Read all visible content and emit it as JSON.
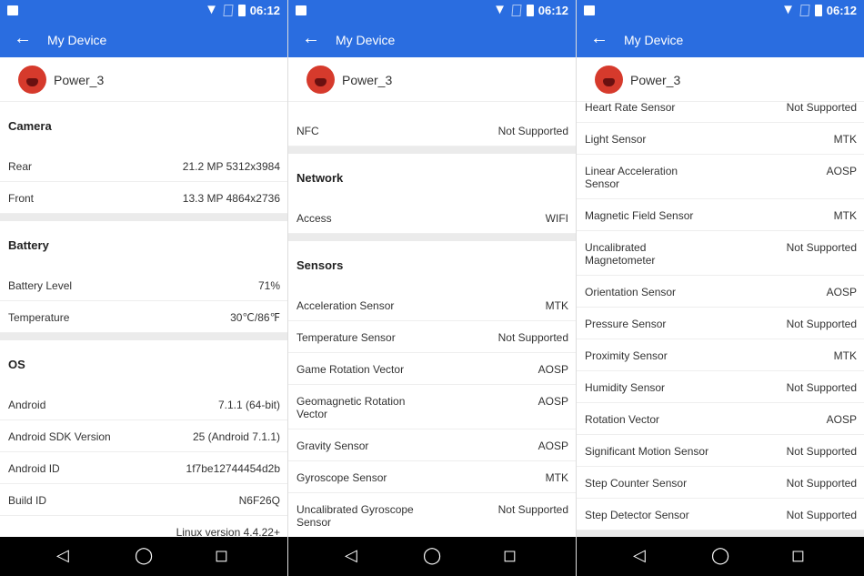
{
  "status": {
    "time": "06:12"
  },
  "appbar": {
    "title": "My Device"
  },
  "device": {
    "name": "Power_3"
  },
  "panels": [
    {
      "items": [
        {
          "type": "section",
          "label": "Camera"
        },
        {
          "type": "row",
          "label": "Rear",
          "value": "21.2 MP 5312x3984"
        },
        {
          "type": "row",
          "label": "Front",
          "value": "13.3 MP 4864x2736"
        },
        {
          "type": "band"
        },
        {
          "type": "section",
          "label": "Battery"
        },
        {
          "type": "row",
          "label": "Battery Level",
          "value": "71%"
        },
        {
          "type": "row",
          "label": "Temperature",
          "value": "30℃/86℉"
        },
        {
          "type": "band"
        },
        {
          "type": "section",
          "label": "OS"
        },
        {
          "type": "row",
          "label": "Android",
          "value": "7.1.1 (64-bit)"
        },
        {
          "type": "row",
          "label": "Android SDK Version",
          "value": "25 (Android 7.1.1)"
        },
        {
          "type": "row",
          "label": "Android ID",
          "value": "1f7be12744454d2b"
        },
        {
          "type": "row",
          "label": "Build ID",
          "value": "N6F26Q"
        },
        {
          "type": "row",
          "label": "",
          "value": "Linux version 4.4.22+"
        }
      ]
    },
    {
      "items": [
        {
          "type": "row",
          "label": "NFC",
          "value": "Not Supported"
        },
        {
          "type": "band"
        },
        {
          "type": "section",
          "label": "Network"
        },
        {
          "type": "row",
          "label": "Access",
          "value": "WIFI"
        },
        {
          "type": "band"
        },
        {
          "type": "section",
          "label": "Sensors"
        },
        {
          "type": "row",
          "label": "Acceleration Sensor",
          "value": "MTK"
        },
        {
          "type": "row",
          "label": "Temperature Sensor",
          "value": "Not Supported"
        },
        {
          "type": "row",
          "label": "Game Rotation Vector",
          "value": "AOSP"
        },
        {
          "type": "row",
          "label": "Geomagnetic Rotation Vector",
          "value": "AOSP",
          "two": true
        },
        {
          "type": "row",
          "label": "Gravity Sensor",
          "value": "AOSP"
        },
        {
          "type": "row",
          "label": "Gyroscope Sensor",
          "value": "MTK"
        },
        {
          "type": "row",
          "label": "Uncalibrated Gyroscope Sensor",
          "value": "Not Supported",
          "two": true
        }
      ]
    },
    {
      "items": [
        {
          "type": "row",
          "label": "Heart Rate Sensor",
          "value": "Not Supported"
        },
        {
          "type": "row",
          "label": "Light Sensor",
          "value": "MTK"
        },
        {
          "type": "row",
          "label": "Linear Acceleration Sensor",
          "value": "AOSP",
          "two": true
        },
        {
          "type": "row",
          "label": "Magnetic Field Sensor",
          "value": "MTK"
        },
        {
          "type": "row",
          "label": "Uncalibrated Magnetometer",
          "value": "Not Supported",
          "two": true
        },
        {
          "type": "row",
          "label": "Orientation Sensor",
          "value": "AOSP"
        },
        {
          "type": "row",
          "label": "Pressure Sensor",
          "value": "Not Supported"
        },
        {
          "type": "row",
          "label": "Proximity Sensor",
          "value": "MTK"
        },
        {
          "type": "row",
          "label": "Humidity Sensor",
          "value": "Not Supported"
        },
        {
          "type": "row",
          "label": "Rotation Vector",
          "value": "AOSP"
        },
        {
          "type": "row",
          "label": "Significant Motion Sensor",
          "value": "Not Supported"
        },
        {
          "type": "row",
          "label": "Step Counter Sensor",
          "value": "Not Supported"
        },
        {
          "type": "row",
          "label": "Step Detector Sensor",
          "value": "Not Supported"
        },
        {
          "type": "band"
        }
      ]
    }
  ],
  "icons": {
    "back": "arrow-left-icon",
    "nav": [
      "back-triangle-icon",
      "home-circle-icon",
      "recents-square-icon"
    ]
  },
  "colors": {
    "accent": "#2a6de0",
    "logo": "#d63a2c"
  }
}
